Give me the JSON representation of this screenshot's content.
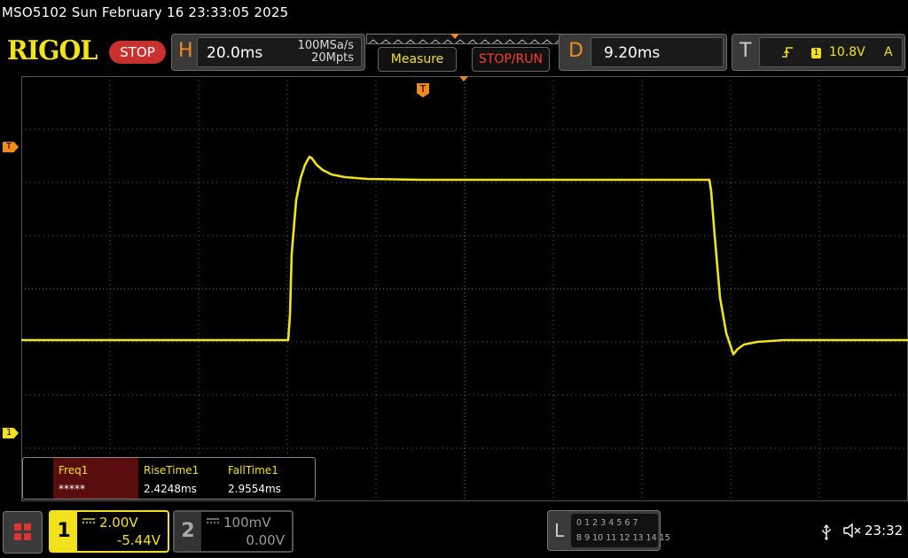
{
  "header": {
    "title_line": "MSO5102  Sun February 16 23:33:05 2025",
    "logo": "RIGOL",
    "run_state": "STOP"
  },
  "horizontal": {
    "letter": "H",
    "timebase": "20.0ms",
    "sample_rate": "100MSa/s",
    "memory_depth": "20Mpts"
  },
  "buttons": {
    "measure": "Measure",
    "stop_run": "STOP/RUN"
  },
  "delay": {
    "letter": "D",
    "value": "9.20ms"
  },
  "trigger": {
    "letter": "T",
    "channel": "1",
    "level": "10.8V",
    "mode": "A",
    "level_marker": "T",
    "position_marker": "T"
  },
  "channel_markers": {
    "ch1": "1"
  },
  "measurements": [
    {
      "name": "Freq1",
      "value": "*****"
    },
    {
      "name": "RiseTime1",
      "value": "2.4248ms"
    },
    {
      "name": "FallTime1",
      "value": "2.9554ms"
    }
  ],
  "channels": [
    {
      "number": "1",
      "scale": "2.00V",
      "offset": "-5.44V",
      "color": "#f2e21b"
    },
    {
      "number": "2",
      "scale": "100mV",
      "offset": "0.00V",
      "color": "#999999"
    }
  ],
  "logic_analyzer": {
    "letter": "L",
    "row1": "0 1 2 3   4 5 6 7",
    "row2": "8  9 10 11  12 13 14 15"
  },
  "status": {
    "time": "23:32"
  },
  "colors": {
    "trace": "#f2e21b",
    "trigger_accent": "#f08a1c",
    "grid": "#5a5a5a",
    "stop_red": "#c8312e"
  },
  "icons": {
    "usb": "usb-icon",
    "speaker": "speaker-muted-icon",
    "menu": "menu-grid-icon",
    "edge": "rising-edge-icon"
  }
}
